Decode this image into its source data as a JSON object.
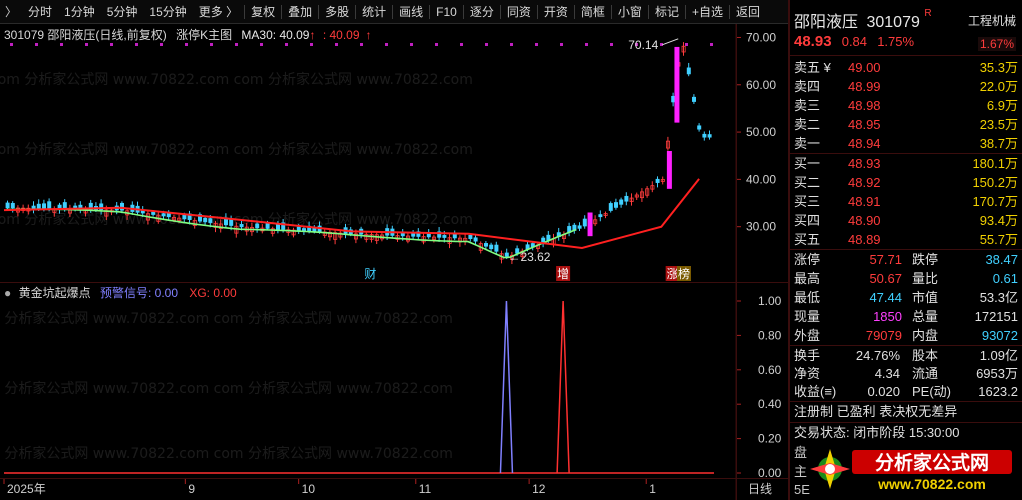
{
  "toolbar": {
    "first": "〉",
    "items": [
      "分时",
      "1分钟",
      "5分钟",
      "15分钟",
      "更多 〉",
      "复权",
      "叠加",
      "多股",
      "统计",
      "画线",
      "F10",
      "逐分",
      "同资",
      "开资",
      "简框",
      "小窗",
      "标记",
      "+自选",
      "返回"
    ]
  },
  "price_title": {
    "code_name": "301079 邵阳液压(日线,前复权)",
    "indicator": "涨停K主图",
    "ma_label": "MA30: 40.09",
    "ma_up": "↑",
    "ma_value2": "40.09",
    "ma_up2": "↑"
  },
  "price_axis": [
    "70.00",
    "60.00",
    "50.00",
    "40.00",
    "30.00"
  ],
  "annotations": {
    "high": "70.14",
    "low": "23.62",
    "cai": "财",
    "zeng": "增",
    "zhang": "涨",
    "bang": "榜"
  },
  "ind_title": {
    "name": "黄金坑起爆点",
    "signal_label": "预警信号:",
    "signal_value": "0.00",
    "xg_label": "XG:",
    "xg_value": "0.00"
  },
  "ind_axis": [
    "1.00",
    "0.80",
    "0.60",
    "0.40",
    "0.20",
    "0.00"
  ],
  "date_axis": {
    "labels": [
      "2025年",
      "9",
      "10",
      "11",
      "12",
      "1"
    ],
    "period": "日线"
  },
  "watermark": "com 分析家公式网 www.70822.com",
  "quote": {
    "name": "邵阳液压",
    "code": "301079",
    "badge": "R",
    "sector": "工程机械",
    "price": "48.93",
    "change": "0.84",
    "pct": "1.75%",
    "sector_pct": "1.67%",
    "asks": [
      {
        "label": "卖五 ¥",
        "price": "49.00",
        "vol": "35.3万"
      },
      {
        "label": "卖四",
        "price": "48.99",
        "vol": "22.0万"
      },
      {
        "label": "卖三",
        "price": "48.98",
        "vol": "6.9万"
      },
      {
        "label": "卖二",
        "price": "48.95",
        "vol": "23.5万"
      },
      {
        "label": "卖一",
        "price": "48.94",
        "vol": "38.7万"
      }
    ],
    "bids": [
      {
        "label": "买一",
        "price": "48.93",
        "vol": "180.1万"
      },
      {
        "label": "买二",
        "price": "48.92",
        "vol": "150.2万"
      },
      {
        "label": "买三",
        "price": "48.91",
        "vol": "170.7万"
      },
      {
        "label": "买四",
        "price": "48.90",
        "vol": "93.4万"
      },
      {
        "label": "买五",
        "price": "48.89",
        "vol": "55.7万"
      }
    ],
    "stats": [
      {
        "l1": "涨停",
        "v1": "57.71",
        "c1": "red",
        "l2": "跌停",
        "v2": "38.47",
        "c2": "cyan"
      },
      {
        "l1": "最高",
        "v1": "50.67",
        "c1": "red",
        "l2": "量比",
        "v2": "0.61",
        "c2": "cyan"
      },
      {
        "l1": "最低",
        "v1": "47.44",
        "c1": "cyan",
        "l2": "市值",
        "v2": "53.3亿",
        "c2": "white"
      },
      {
        "l1": "现量",
        "v1": "1850",
        "c1": "magenta",
        "l2": "总量",
        "v2": "172151",
        "c2": "white"
      },
      {
        "l1": "外盘",
        "v1": "79079",
        "c1": "red",
        "l2": "内盘",
        "v2": "93072",
        "c2": "cyan"
      }
    ],
    "stats2": [
      {
        "l1": "换手",
        "v1": "24.76%",
        "l2": "股本",
        "v2": "1.09亿"
      },
      {
        "l1": "净资",
        "v1": "4.34",
        "l2": "流通",
        "v2": "6953万"
      },
      {
        "l1": "收益(≡)",
        "v1": "0.020",
        "l2": "PE(动)",
        "v2": "1623.2"
      }
    ],
    "reg": "注册制 已盈利 表决权无差异",
    "status_label": "交易状态:",
    "status_value": "闭市阶段 15:30:00",
    "extra1": "盘",
    "extra2": "主",
    "extra3": "5E"
  },
  "logo": {
    "main": "分析家公式网",
    "url": "www.70822.com"
  },
  "colors": {
    "up": "#ff3c3c",
    "down": "#40d0ff",
    "limit_up": "#ff20ff",
    "ma30": "#ff2020",
    "trend": "#80ff80",
    "signal_blue": "#8080ff",
    "signal_red": "#ff3030"
  },
  "chart_data": {
    "type": "line",
    "title": "301079 邵阳液压(日线,前复权)",
    "ylim": [
      20,
      72
    ],
    "ma30_series": {
      "name": "MA30",
      "x": [
        "2025-07-15",
        "2025-08-15",
        "2025-09-15",
        "2025-10-15",
        "2025-11-15",
        "2025-12-15",
        "2026-01-05",
        "2026-01-15"
      ],
      "y": [
        33.5,
        34.0,
        31.5,
        29.0,
        28.5,
        25.5,
        30.0,
        40.1
      ]
    },
    "close_series": {
      "name": "close",
      "x": [
        "2025-07-15",
        "2025-08-15",
        "2025-09-15",
        "2025-10-15",
        "2025-11-15",
        "2025-11-25",
        "2025-12-15",
        "2026-01-05",
        "2026-01-10",
        "2026-01-15"
      ],
      "y": [
        34.0,
        33.5,
        30.0,
        28.5,
        27.5,
        23.62,
        30.0,
        40.0,
        70.14,
        48.93
      ]
    },
    "indicator": {
      "name": "黄金坑起爆点",
      "ylim": [
        0,
        1
      ],
      "signals": [
        {
          "series": "预警信号",
          "date": "2025-11-25",
          "value": 1.0
        },
        {
          "series": "XG",
          "date": "2025-12-10",
          "value": 1.0
        }
      ]
    }
  }
}
